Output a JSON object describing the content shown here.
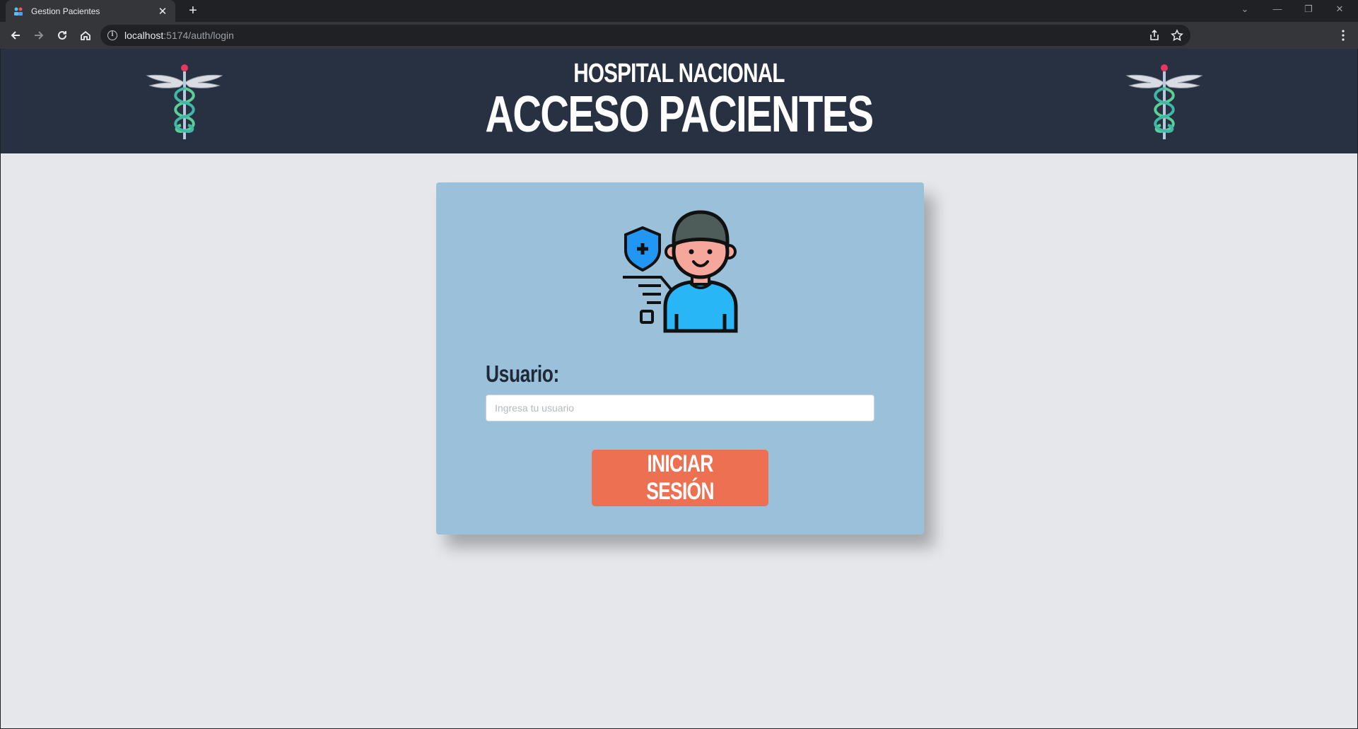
{
  "browser": {
    "tab_title": "Gestion Pacientes",
    "url_host": "localhost",
    "url_path": ":5174/auth/login",
    "tab_close": "✕",
    "new_tab": "+",
    "window_controls": {
      "dropdown": "⌄",
      "minimize": "—",
      "restore": "❐",
      "close": "✕"
    }
  },
  "header": {
    "title_line1": "HOSPITAL NACIONAL",
    "title_line2": "ACCESO PACIENTES",
    "logo_icon": "caduceus-icon",
    "color": "#283141"
  },
  "login": {
    "user_label": "Usuario:",
    "user_placeholder": "Ingresa tu usuario",
    "user_value": "",
    "submit_label": "INICIAR SESIÓN",
    "avatar_icon": "patient-avatar-icon",
    "card_color": "#9ac0da",
    "button_color": "#ee7052"
  }
}
